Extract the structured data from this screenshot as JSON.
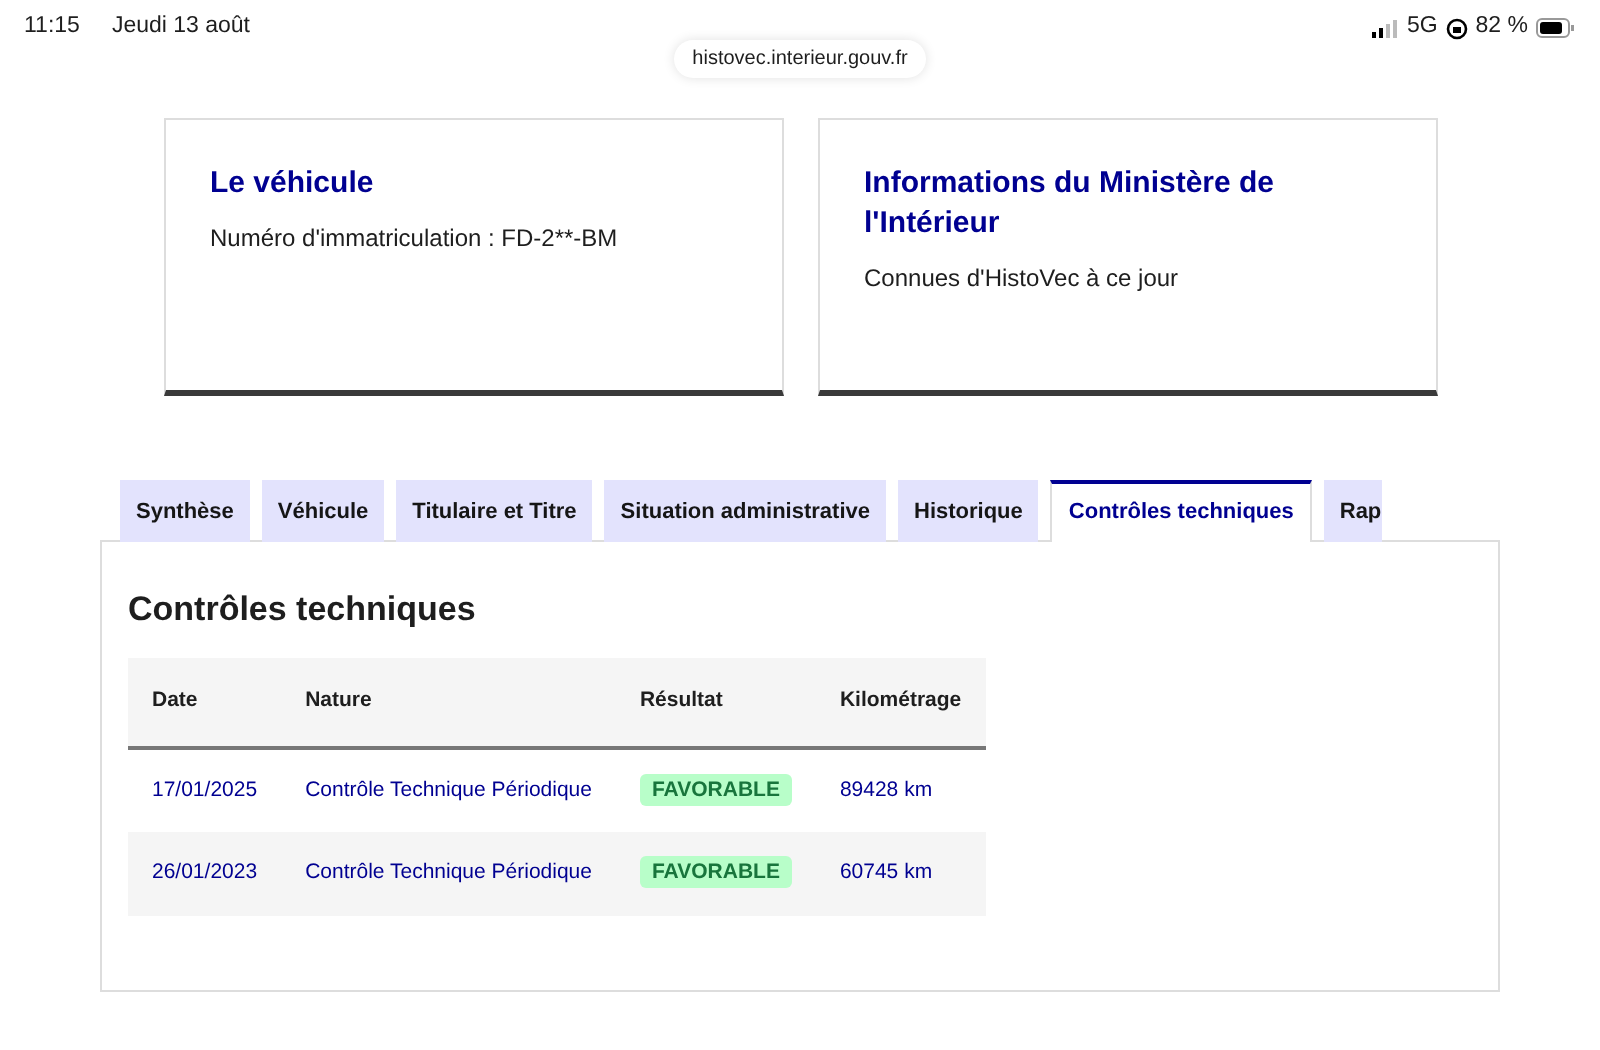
{
  "status_bar": {
    "time": "11:15",
    "date": "Jeudi 13 août",
    "network": "5G",
    "battery": "82 %"
  },
  "address_bar": {
    "url": "histovec.interieur.gouv.fr"
  },
  "cards": [
    {
      "title": "Le véhicule",
      "text": "Numéro d'immatriculation : FD-2**-BM"
    },
    {
      "title": "Informations du Ministère de l'Intérieur",
      "text": "Connues d'HistoVec à ce jour"
    }
  ],
  "tabs": [
    {
      "label": "Synthèse",
      "selected": false
    },
    {
      "label": "Véhicule",
      "selected": false
    },
    {
      "label": "Titulaire et Titre",
      "selected": false
    },
    {
      "label": "Situation administrative",
      "selected": false
    },
    {
      "label": "Historique",
      "selected": false
    },
    {
      "label": "Contrôles techniques",
      "selected": true
    },
    {
      "label": "Rap",
      "selected": false
    }
  ],
  "panel": {
    "title": "Contrôles techniques",
    "table": {
      "columns": [
        "Date",
        "Nature",
        "Résultat",
        "Kilométrage"
      ],
      "rows": [
        {
          "date": "17/01/2025",
          "nature": "Contrôle Technique Périodique",
          "result": "FAVORABLE",
          "mileage": "89428 km"
        },
        {
          "date": "26/01/2023",
          "nature": "Contrôle Technique Périodique",
          "result": "FAVORABLE",
          "mileage": "60745 km"
        }
      ]
    }
  }
}
